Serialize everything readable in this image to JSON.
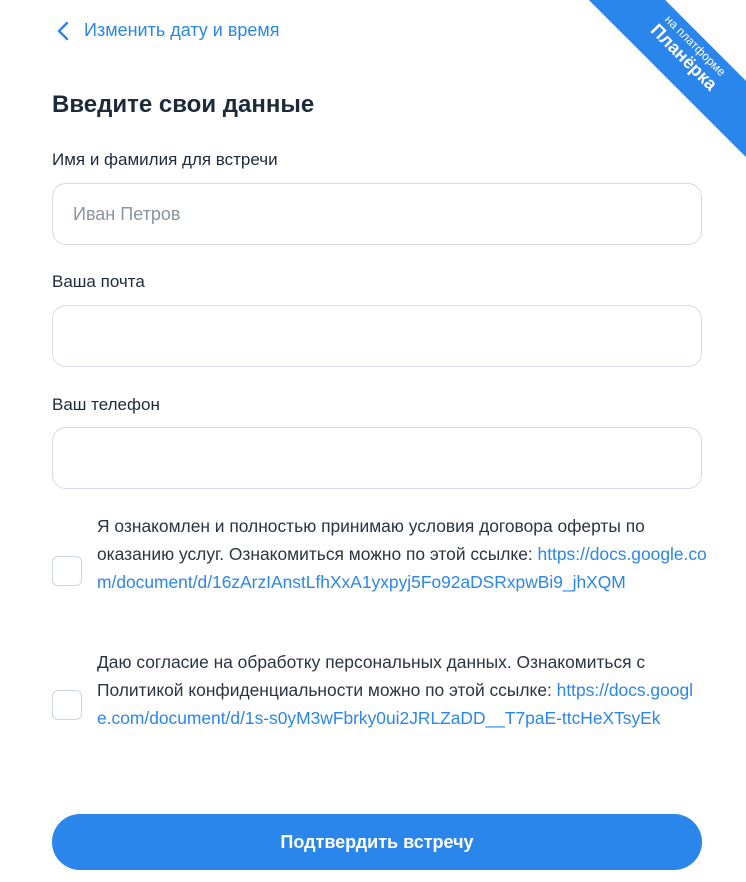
{
  "ribbon": {
    "line1": "на платформе",
    "line2": "Планёрка"
  },
  "nav": {
    "back_label": "Изменить дату и время"
  },
  "form": {
    "title": "Введите свои данные",
    "name_label": "Имя и фамилия для встречи",
    "name_placeholder": "Иван Петров",
    "name_value": "",
    "email_label": "Ваша почта",
    "email_placeholder": "",
    "email_value": "",
    "phone_label": "Ваш телефон",
    "phone_placeholder": "",
    "phone_value": ""
  },
  "consents": [
    {
      "checked": false,
      "text": "Я ознакомлен и полностью принимаю условия договора оферты по оказанию услуг. Ознакомиться можно по этой ссылке: ",
      "link": "https://docs.google.com/document/d/16zArzIAnstLfhXxA1yxpyj5Fo92aDSRxpwBi9_jhXQM"
    },
    {
      "checked": false,
      "text": "Даю согласие на обработку персональных данных. Ознакомиться с Политикой конфиденциальности можно по этой ссылке: ",
      "link": "https://docs.google.com/document/d/1s-s0yM3wFbrky0ui2JRLZaDD__T7paE-ttcHeXTsyEk"
    }
  ],
  "actions": {
    "confirm_label": "Подтвердить встречу"
  },
  "colors": {
    "accent": "#2b86ec",
    "text": "#1d2a3a",
    "border": "#d6dbe2",
    "placeholder": "#8a939e"
  }
}
